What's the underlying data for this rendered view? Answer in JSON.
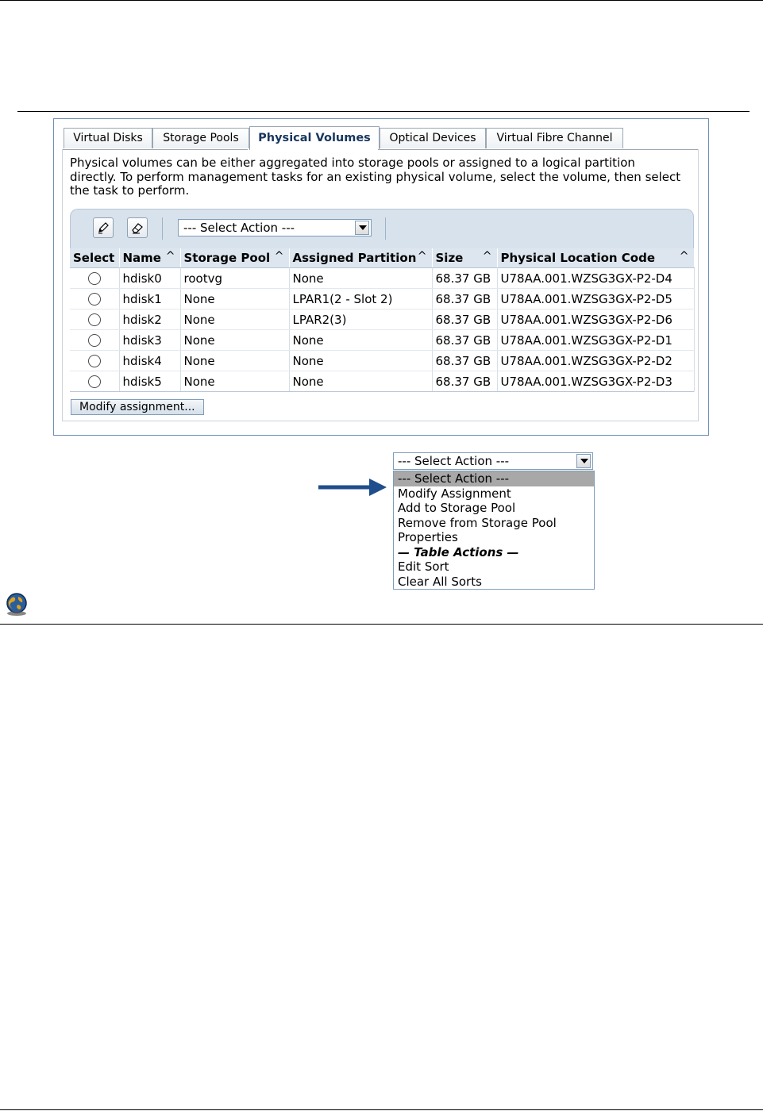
{
  "tabs": [
    {
      "label": "Virtual Disks",
      "active": false
    },
    {
      "label": "Storage Pools",
      "active": false
    },
    {
      "label": "Physical Volumes",
      "active": true
    },
    {
      "label": "Optical Devices",
      "active": false
    },
    {
      "label": "Virtual Fibre Channel",
      "active": false
    }
  ],
  "description": "Physical volumes can be either aggregated into storage pools or assigned to a logical partition directly. To perform management tasks for an existing physical volume, select the volume, then select the task to perform.",
  "toolbar": {
    "edit_icon": "pencil-icon",
    "clear_icon": "eraser-icon",
    "select_action_value": "--- Select Action ---"
  },
  "table": {
    "columns": [
      "Select",
      "Name",
      "Storage Pool",
      "Assigned Partition",
      "Size",
      "Physical Location Code"
    ],
    "sort_indicator": "^",
    "rows": [
      {
        "name": "hdisk0",
        "pool": "rootvg",
        "partition": "None",
        "size": "68.37 GB",
        "location": "U78AA.001.WZSG3GX-P2-D4"
      },
      {
        "name": "hdisk1",
        "pool": "None",
        "partition": "LPAR1(2 - Slot 2)",
        "size": "68.37 GB",
        "location": "U78AA.001.WZSG3GX-P2-D5"
      },
      {
        "name": "hdisk2",
        "pool": "None",
        "partition": "LPAR2(3)",
        "size": "68.37 GB",
        "location": "U78AA.001.WZSG3GX-P2-D6"
      },
      {
        "name": "hdisk3",
        "pool": "None",
        "partition": "None",
        "size": "68.37 GB",
        "location": "U78AA.001.WZSG3GX-P2-D1"
      },
      {
        "name": "hdisk4",
        "pool": "None",
        "partition": "None",
        "size": "68.37 GB",
        "location": "U78AA.001.WZSG3GX-P2-D2"
      },
      {
        "name": "hdisk5",
        "pool": "None",
        "partition": "None",
        "size": "68.37 GB",
        "location": "U78AA.001.WZSG3GX-P2-D3"
      }
    ]
  },
  "modify_button": "Modify assignment...",
  "dropdown_expanded": {
    "value": "--- Select Action ---",
    "options": [
      {
        "label": "--- Select Action ---",
        "selected": true,
        "group": false
      },
      {
        "label": "Modify Assignment",
        "selected": false,
        "group": false
      },
      {
        "label": "Add to Storage Pool",
        "selected": false,
        "group": false
      },
      {
        "label": "Remove from Storage Pool",
        "selected": false,
        "group": false
      },
      {
        "label": "Properties",
        "selected": false,
        "group": false
      },
      {
        "label": "— Table Actions —",
        "selected": false,
        "group": true
      },
      {
        "label": "Edit Sort",
        "selected": false,
        "group": false
      },
      {
        "label": "Clear All Sorts",
        "selected": false,
        "group": false
      }
    ]
  },
  "colors": {
    "active_tab_text": "#17365d",
    "toolbar_bg": "#d8e2ec",
    "header_bg": "#dde6ef",
    "arrow": "#1f4e8c",
    "selected_option_bg": "#a8a8a8"
  },
  "icons": {
    "callout_arrow": "right-arrow-icon",
    "globe": "globe-icon"
  }
}
